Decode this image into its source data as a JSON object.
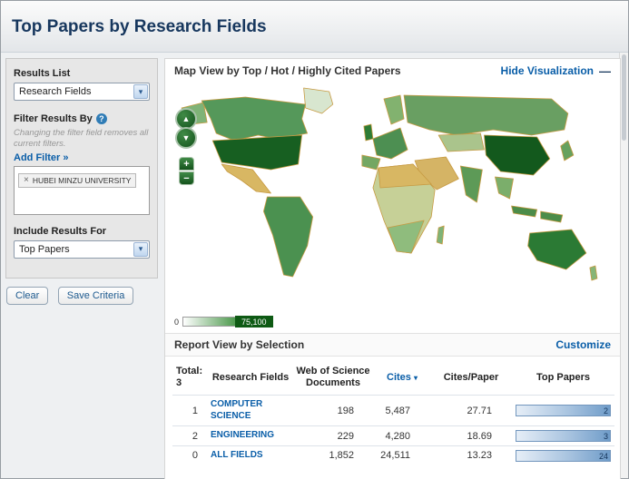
{
  "icons": {
    "chevron_down": "▾",
    "help": "?",
    "close": "×",
    "hide_minus": "—",
    "plus": "+",
    "minus": "−",
    "pan_up": "▲",
    "pan_down": "▼",
    "sort_down": "▾"
  },
  "header": {
    "title": "Top Papers by Research Fields"
  },
  "sidebar": {
    "results_list_label": "Results List",
    "results_list_value": "Research Fields",
    "filter_by_label": "Filter Results By",
    "filter_note": "Changing the filter field removes all current filters.",
    "add_filter_label": "Add Filter »",
    "filter_chip_label": "HUBEI MINZU UNIVERSITY",
    "include_label": "Include Results For",
    "include_value": "Top Papers",
    "clear_button": "Clear",
    "save_button": "Save Criteria"
  },
  "map": {
    "title": "Map View by Top / Hot / Highly Cited Papers",
    "hide_link": "Hide Visualization",
    "legend_min": "0",
    "legend_max": "75,100",
    "legend_min_color": "#ffffff",
    "legend_max_color": "#0e5a14"
  },
  "report": {
    "title": "Report View by Selection",
    "customize_link": "Customize",
    "total_label": "Total: 3",
    "columns": {
      "field": "Research Fields",
      "docs": "Web of Science Documents",
      "cites": "Cites",
      "cites_per_paper": "Cites/Paper",
      "top_papers": "Top Papers"
    },
    "rows": [
      {
        "rank": "1",
        "field": "COMPUTER SCIENCE",
        "docs": "198",
        "cites": "5,487",
        "cites_per_paper": "27.71",
        "top_papers": "2"
      },
      {
        "rank": "2",
        "field": "ENGINEERING",
        "docs": "229",
        "cites": "4,280",
        "cites_per_paper": "18.69",
        "top_papers": "3"
      },
      {
        "rank": "0",
        "field": "ALL FIELDS",
        "docs": "1,852",
        "cites": "24,511",
        "cites_per_paper": "13.23",
        "top_papers": "24"
      }
    ]
  }
}
